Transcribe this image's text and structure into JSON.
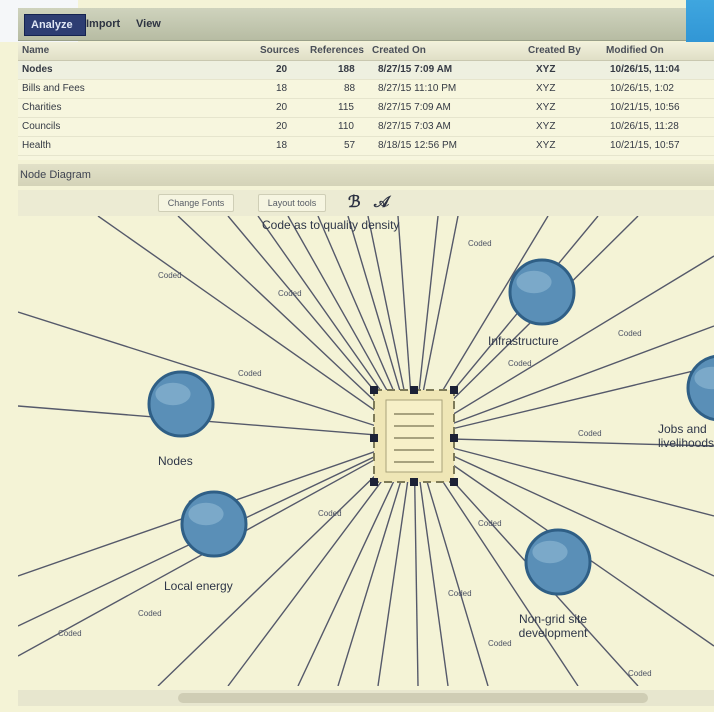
{
  "ribbon": {
    "tabs": [
      {
        "label": "Analyze",
        "active": true
      },
      {
        "label": "Import",
        "active": false
      },
      {
        "label": "View",
        "active": false
      }
    ]
  },
  "grid": {
    "columns": [
      "Name",
      "",
      "Sources",
      "References",
      "Created On",
      "Created By",
      "Modified On"
    ],
    "rows": [
      {
        "name": "Nodes",
        "sources": "20",
        "references": "188",
        "created_on": "8/27/15 7:09 AM",
        "created_by": "XYZ",
        "modified_on": "10/26/15, 11:04"
      },
      {
        "name": "Bills and Fees",
        "sources": "18",
        "references": "88",
        "created_on": "8/27/15 11:10 PM",
        "created_by": "XYZ",
        "modified_on": "10/26/15, 1:02"
      },
      {
        "name": "Charities",
        "sources": "20",
        "references": "115",
        "created_on": "8/27/15 7:09 AM",
        "created_by": "XYZ",
        "modified_on": "10/21/15, 10:56"
      },
      {
        "name": "Councils",
        "sources": "20",
        "references": "110",
        "created_on": "8/27/15 7:03 AM",
        "created_by": "XYZ",
        "modified_on": "10/26/15, 11:28"
      },
      {
        "name": "Health",
        "sources": "18",
        "references": "57",
        "created_on": "8/18/15 12:56 PM",
        "created_by": "XYZ",
        "modified_on": "10/21/15, 10:57"
      }
    ]
  },
  "diagram": {
    "title": "Node Diagram",
    "toolbar": {
      "btn1": "Change Fonts",
      "btn2": "Layout tools"
    },
    "labels": {
      "quality": "Code as to quality density",
      "infrastructure": "Infrastructure",
      "jobs": "Jobs and livelihoods",
      "nodes": "Nodes",
      "local_energy": "Local energy",
      "development": "Non-grid site development"
    },
    "edge_label": "Coded",
    "colors": {
      "background": "#f4f3d6",
      "node": "#5a8fb7",
      "node_rim": "#2f5f86",
      "edge": "#3a3f58",
      "doc": "#efe6b6"
    }
  }
}
